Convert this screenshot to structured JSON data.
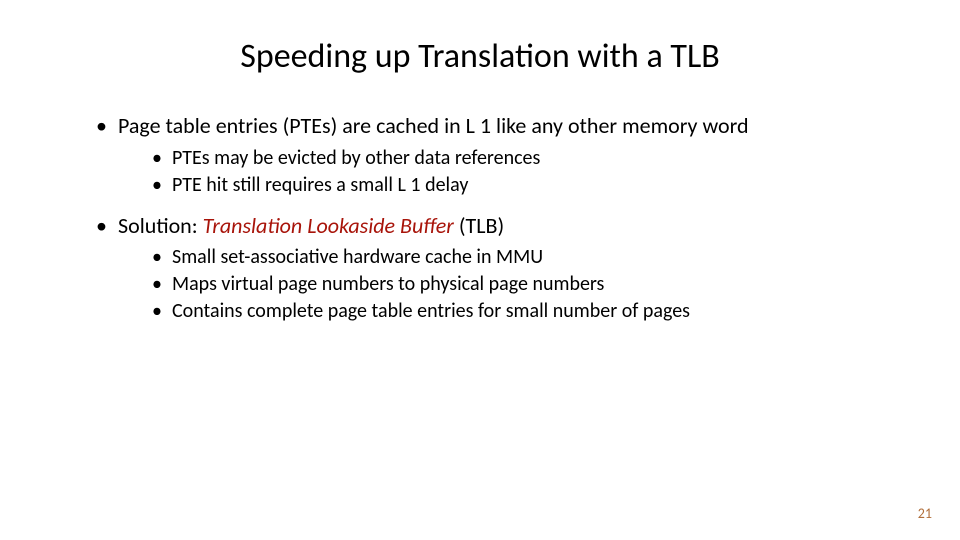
{
  "title": "Speeding up Translation with a TLB",
  "bullets": {
    "b1": "Page table entries (PTEs) are cached in L 1 like any other memory word",
    "b1_sub1": "PTEs may be evicted by other data references",
    "b1_sub2": "PTE hit still requires a small L 1 delay",
    "b2_prefix": "Solution: ",
    "b2_term": "Translation Lookaside Buffer",
    "b2_abbr": " (TLB)",
    "b2_sub1": "Small set-associative hardware cache in MMU",
    "b2_sub2": "Maps virtual page numbers to  physical page numbers",
    "b2_sub3": "Contains complete page table entries for small number of pages"
  },
  "page_number": "21",
  "colors": {
    "solution_term": "#a8140a",
    "pagenum": "#b06e3a"
  }
}
